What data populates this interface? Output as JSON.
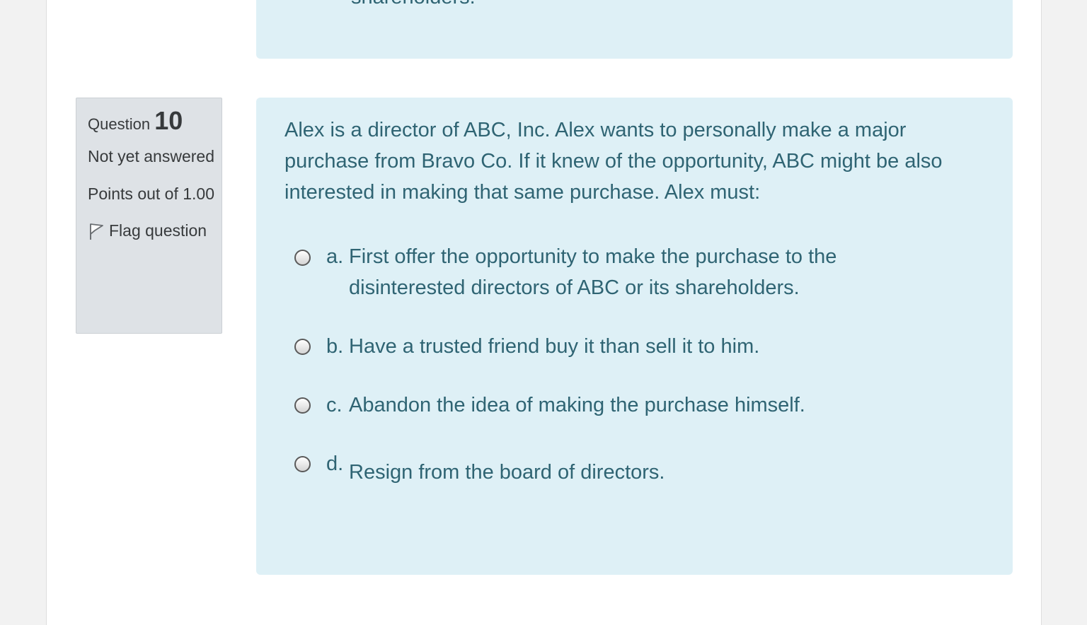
{
  "previous_question": {
    "visible_text_fragment": "shareholders."
  },
  "question": {
    "label_prefix": "Question",
    "number": "10",
    "state": "Not yet answered",
    "grade": "Points out of 1.00",
    "flag_label": "Flag question",
    "text": "Alex is a director of ABC, Inc. Alex wants to personally make a major purchase from Bravo Co. If it knew of the opportunity, ABC might be also interested in making that same purchase. Alex must:",
    "options": [
      {
        "letter": "a.",
        "text": "First offer the opportunity to make the purchase to the disinterested directors of ABC or its shareholders."
      },
      {
        "letter": "b.",
        "text": "Have a trusted friend buy it than sell it to him."
      },
      {
        "letter": "c.",
        "text": "Abandon the idea of making the purchase himself."
      },
      {
        "letter": "d.",
        "text": "Resign from the board of directors."
      }
    ]
  },
  "colors": {
    "page_background": "#f2f2f2",
    "content_background": "#ffffff",
    "info_panel": "#dee2e6",
    "formulation_background": "#def0f6",
    "formulation_text": "#2f6473",
    "info_text": "#373a3c"
  }
}
